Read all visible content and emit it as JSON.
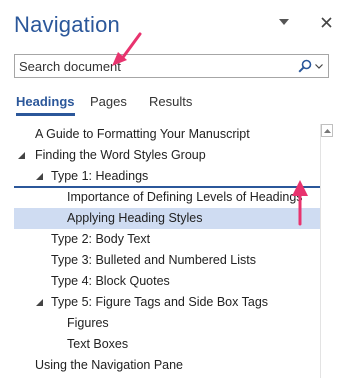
{
  "pane": {
    "title": "Navigation",
    "menu_icon": "dropdown-triangle-icon",
    "close_icon": "close-icon"
  },
  "search": {
    "placeholder": "Search document",
    "value": "",
    "icon": "magnifier-icon",
    "dropdown_icon": "chevron-down-icon"
  },
  "tabs": [
    {
      "label": "Headings",
      "active": true
    },
    {
      "label": "Pages",
      "active": false
    },
    {
      "label": "Results",
      "active": false
    }
  ],
  "headings": [
    {
      "label": "A Guide to Formatting Your Manuscript",
      "level": 1,
      "expanded": null
    },
    {
      "label": "Finding the Word Styles Group",
      "level": 1,
      "expanded": true
    },
    {
      "label": "Type 1: Headings",
      "level": 2,
      "expanded": true
    },
    {
      "label": "Importance of Defining Levels of Headings",
      "level": 3,
      "expanded": null
    },
    {
      "label": "Applying Heading Styles",
      "level": 3,
      "expanded": null,
      "selected": true
    },
    {
      "label": "Type 2: Body Text",
      "level": 2,
      "expanded": null
    },
    {
      "label": "Type 3: Bulleted and Numbered Lists",
      "level": 2,
      "expanded": null
    },
    {
      "label": "Type 4: Block Quotes",
      "level": 2,
      "expanded": null
    },
    {
      "label": "Type 5: Figure Tags and Side Box Tags",
      "level": 2,
      "expanded": true
    },
    {
      "label": "Figures",
      "level": 3,
      "expanded": null
    },
    {
      "label": "Text Boxes",
      "level": 3,
      "expanded": null
    },
    {
      "label": "Using the Navigation Pane",
      "level": 1,
      "expanded": null
    }
  ],
  "colors": {
    "accent": "#2b579a",
    "selection": "#cfdcf2",
    "annotation_arrow": "#e8336e"
  }
}
